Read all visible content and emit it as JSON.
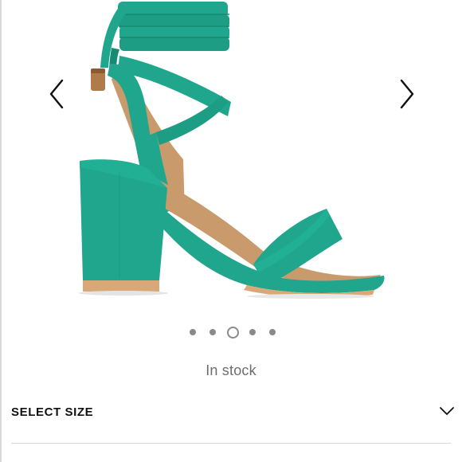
{
  "product": {
    "image": {
      "subject": "teal suede lace-up block heel sandal",
      "colors": {
        "suede": "#1fa68c",
        "shade": "#168a73",
        "lining": "#c99a6c",
        "sole": "#d8a878"
      }
    },
    "carousel": {
      "prev_icon": "chevron-left-icon",
      "next_icon": "chevron-right-icon",
      "slide_count": 5,
      "active_index": 3
    },
    "stock_status": "In stock",
    "size_selector": {
      "label": "SELECT SIZE",
      "icon": "chevron-down-icon",
      "expanded": false
    }
  }
}
